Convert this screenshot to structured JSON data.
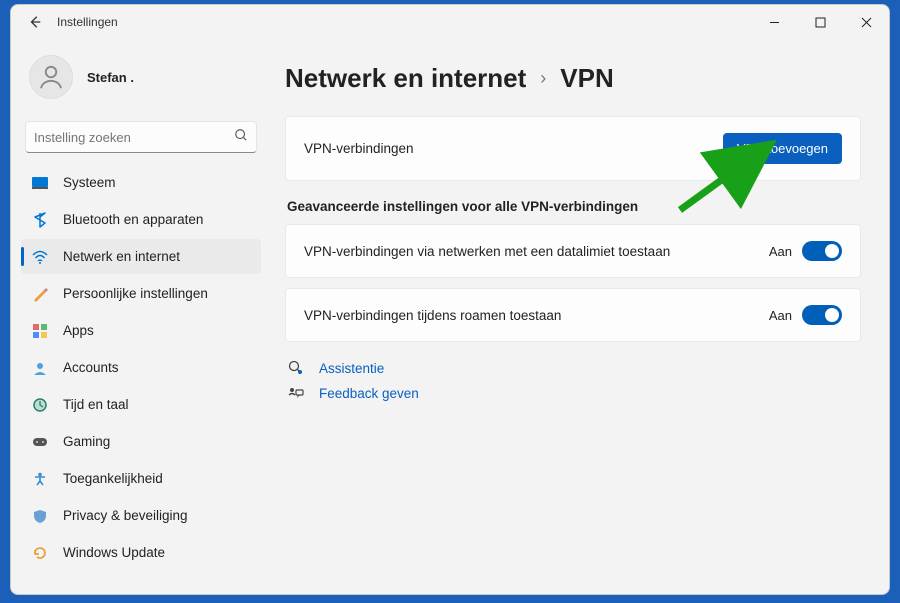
{
  "window": {
    "title": "Instellingen"
  },
  "user": {
    "name": "Stefan ."
  },
  "search": {
    "placeholder": "Instelling zoeken"
  },
  "sidebar": {
    "items": [
      {
        "label": "Systeem",
        "icon": "system"
      },
      {
        "label": "Bluetooth en apparaten",
        "icon": "bluetooth"
      },
      {
        "label": "Netwerk en internet",
        "icon": "network",
        "active": true
      },
      {
        "label": "Persoonlijke instellingen",
        "icon": "personalize"
      },
      {
        "label": "Apps",
        "icon": "apps"
      },
      {
        "label": "Accounts",
        "icon": "accounts"
      },
      {
        "label": "Tijd en taal",
        "icon": "time"
      },
      {
        "label": "Gaming",
        "icon": "gaming"
      },
      {
        "label": "Toegankelijkheid",
        "icon": "accessibility"
      },
      {
        "label": "Privacy & beveiliging",
        "icon": "privacy"
      },
      {
        "label": "Windows Update",
        "icon": "update"
      }
    ]
  },
  "breadcrumb": {
    "parent": "Netwerk en internet",
    "current": "VPN"
  },
  "vpn_card": {
    "label": "VPN-verbindingen",
    "button": "VPN toevoegen"
  },
  "advanced": {
    "heading": "Geavanceerde instellingen voor alle VPN-verbindingen",
    "items": [
      {
        "label": "VPN-verbindingen via netwerken met een datalimiet toestaan",
        "state": "Aan"
      },
      {
        "label": "VPN-verbindingen tijdens roamen toestaan",
        "state": "Aan"
      }
    ]
  },
  "links": {
    "help": "Assistentie",
    "feedback": "Feedback geven"
  }
}
